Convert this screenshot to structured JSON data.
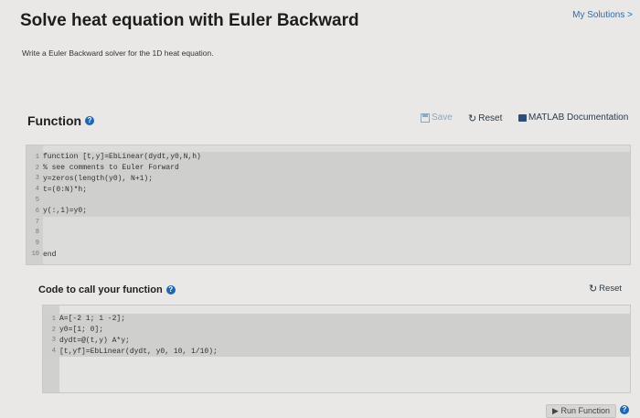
{
  "header": {
    "title": "Solve heat equation with Euler Backward",
    "my_solutions": "My Solutions >",
    "description": "Write a Euler Backward solver for the 1D heat equation."
  },
  "function_section": {
    "heading": "Function",
    "help_icon": "?",
    "toolbar": {
      "save": "Save",
      "reset": "Reset",
      "matlab_doc": "MATLAB Documentation"
    },
    "code_lines": [
      {
        "num": "1",
        "text": "function [t,y]=EbLinear(dydt,y0,N,h)"
      },
      {
        "num": "2",
        "text": "% see comments to Euler Forward"
      },
      {
        "num": "3",
        "text": "y=zeros(length(y0), N+1);"
      },
      {
        "num": "4",
        "text": "t=(0:N)*h;"
      },
      {
        "num": "5",
        "text": ""
      },
      {
        "num": "6",
        "text": "y(:,1)=y0;"
      },
      {
        "num": "7",
        "text": ""
      },
      {
        "num": "8",
        "text": ""
      },
      {
        "num": "9",
        "text": ""
      },
      {
        "num": "10",
        "text": "end"
      }
    ]
  },
  "call_section": {
    "heading": "Code to call your function",
    "reset": "Reset",
    "code_lines": [
      {
        "num": "1",
        "text": "A=[-2 1; 1 -2];"
      },
      {
        "num": "2",
        "text": "y0=[1; 0];"
      },
      {
        "num": "3",
        "text": "dydt=@(t,y) A*y;"
      },
      {
        "num": "4",
        "text": "[t,yf]=EbLinear(dydt, y0, 10, 1/10);"
      }
    ]
  },
  "footer": {
    "run_button": "Run Function"
  },
  "colors": {
    "accent": "#1f67b1",
    "link": "#2a6db0"
  }
}
